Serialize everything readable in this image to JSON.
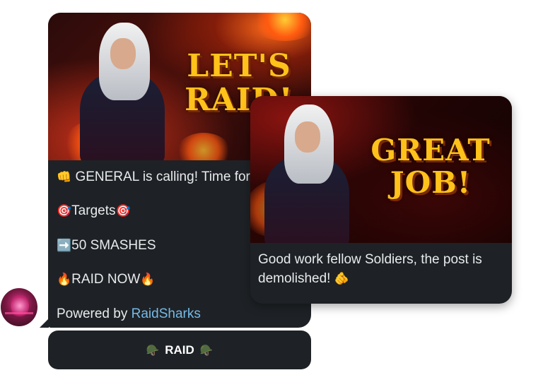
{
  "avatar": {
    "icon": "avatar"
  },
  "raid_post": {
    "banner_text_line1": "LET'S",
    "banner_text_line2": "RAID!",
    "lines": [
      {
        "emoji": "👊",
        "text": " GENERAL is calling! Time for"
      },
      {
        "emoji_before": "🎯",
        "text": "Targets",
        "emoji_after": "🎯"
      },
      {
        "emoji": "➡️",
        "text": "50 SMASHES"
      },
      {
        "emoji_before": "🔥",
        "text": "RAID NOW",
        "emoji_after": "🔥"
      }
    ],
    "powered_prefix": "Powered by ",
    "powered_link": "RaidSharks"
  },
  "raid_button": {
    "emoji": "🪖",
    "label": "RAID"
  },
  "success_post": {
    "banner_text_line1": "GREAT",
    "banner_text_line2": "JOB!",
    "text": "Good work fellow Soldiers, the post is demolished!",
    "emoji": "🫵"
  },
  "colors": {
    "bubble": "#1e2226",
    "link": "#76b9e6",
    "banner_text": "#ffc21a"
  }
}
